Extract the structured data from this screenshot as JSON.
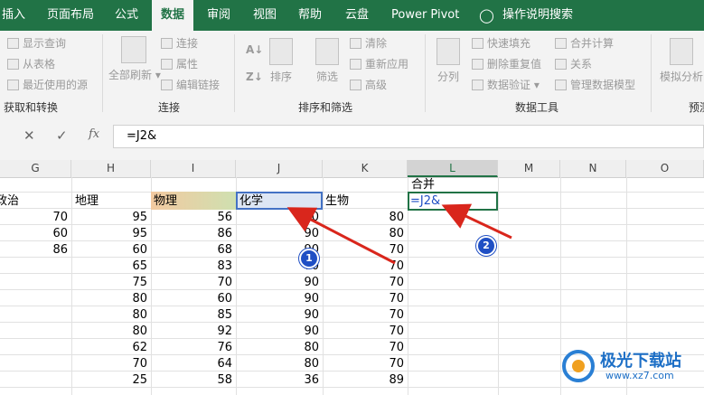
{
  "ribbon_tabs": [
    "插入",
    "页面布局",
    "公式",
    "数据",
    "审阅",
    "视图",
    "帮助",
    "云盘",
    "Power Pivot",
    "操作说明搜索"
  ],
  "active_tab": "数据",
  "ribbon": {
    "get_transform": {
      "items": [
        "显示查询",
        "从表格",
        "最近使用的源"
      ],
      "label": "获取和转换"
    },
    "connections": {
      "refresh_all": "全部刷新",
      "items": [
        "连接",
        "属性",
        "编辑链接"
      ],
      "label": "连接"
    },
    "sort_filter": {
      "sort": "排序",
      "filter": "筛选",
      "clear": "清除",
      "reapply": "重新应用",
      "advanced": "高级",
      "label": "排序和筛选"
    },
    "data_tools": {
      "split": "分列",
      "items_a": [
        "快速填充",
        "删除重复值",
        "数据验证"
      ],
      "items_b": [
        "合并计算",
        "关系",
        "管理数据模型"
      ],
      "label": "数据工具"
    },
    "forecast": {
      "whatif": "模拟分析",
      "label_partial": "预测"
    }
  },
  "formula_bar": {
    "cancel": "✕",
    "enter": "✓",
    "fx": "fx",
    "content": "=J2&"
  },
  "columns": [
    "G",
    "H",
    "I",
    "J",
    "K",
    "L",
    "M",
    "N",
    "O"
  ],
  "headers": {
    "G": "政治",
    "H": "地理",
    "I": "物理",
    "J": "化学",
    "K": "生物",
    "L_top": "合并"
  },
  "active_cell_text": "=J2&",
  "rows": [
    {
      "G": "70",
      "H": "95",
      "I": "56",
      "J": "80",
      "K": "80"
    },
    {
      "G": "60",
      "H": "95",
      "I": "86",
      "J": "90",
      "K": "80"
    },
    {
      "G": "86",
      "H": "60",
      "I": "68",
      "J": "90",
      "K": "70"
    },
    {
      "G": "",
      "H": "65",
      "I": "83",
      "J": "70",
      "K": "70"
    },
    {
      "G": "",
      "H": "75",
      "I": "70",
      "J": "90",
      "K": "70"
    },
    {
      "G": "",
      "H": "80",
      "I": "60",
      "J": "90",
      "K": "70"
    },
    {
      "G": "",
      "H": "80",
      "I": "85",
      "J": "90",
      "K": "70"
    },
    {
      "G": "",
      "H": "80",
      "I": "92",
      "J": "90",
      "K": "70"
    },
    {
      "G": "",
      "H": "62",
      "I": "76",
      "J": "80",
      "K": "70"
    },
    {
      "G": "",
      "H": "70",
      "I": "64",
      "J": "80",
      "K": "70"
    },
    {
      "G": "",
      "H": "25",
      "I": "58",
      "J": "36",
      "K": "89"
    }
  ],
  "annotations": [
    "1",
    "2"
  ],
  "watermark": {
    "title": "极光下载站",
    "url": "www.xz7.com"
  },
  "colors": {
    "excel_green": "#217346",
    "arrow_red": "#d9261c",
    "badge_blue": "#1f4fc4"
  }
}
